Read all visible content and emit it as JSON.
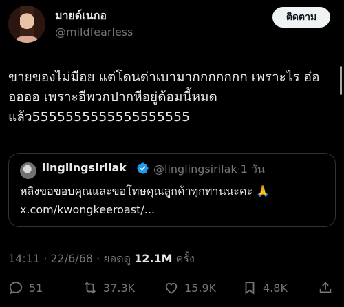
{
  "author": {
    "display_name": "มายด์เนกอ",
    "handle": "@mildfearless"
  },
  "follow_button_label": "ติดตาม",
  "tweet": {
    "text": "ขายของไม่มีอย แต่โดนด่าเบามากกกกกกก เพราะไร อ๋อ\nออออ เพราะอีพวกปากหีอยู่ด้อมนี้หมด\nแล้ว5555555555555555555"
  },
  "quote": {
    "name": "linglingsirilak",
    "handle": "@linglingsirilak·1 วัน",
    "text": "หลิงขอขอบคุณและขอโทษคุณลูกค้าทุกท่านนะคะ 🙏",
    "link": "x.com/kwongkeeroast/..."
  },
  "meta": {
    "time_date": "14:11 · 22/6/68 · ยอดดู ",
    "views": "12.1M",
    "views_suffix": " ครั้ง"
  },
  "actions": {
    "replies": "51",
    "reposts": "37.3K",
    "likes": "15.9K",
    "bookmarks": "4.8K"
  },
  "icons": {
    "verified_color": "#1d9bf0",
    "action_color": "#71767b"
  }
}
